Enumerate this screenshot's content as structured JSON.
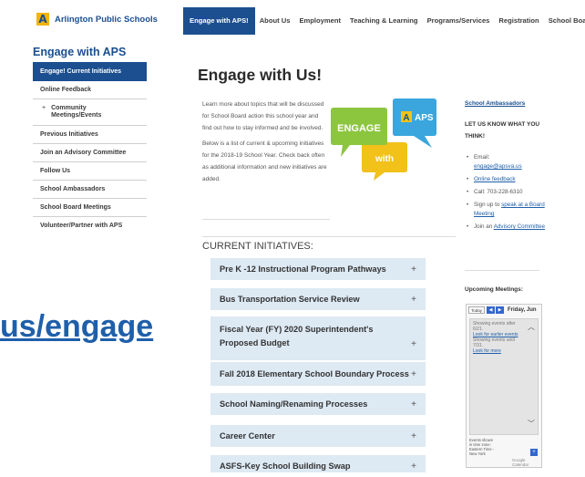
{
  "header": {
    "logo_letter": "A",
    "logo_text": "Arlington Public Schools",
    "nav": [
      "Engage with APS!",
      "About Us",
      "Employment",
      "Teaching & Learning",
      "Programs/Services",
      "Registration",
      "School Board"
    ]
  },
  "sidebar": {
    "title": "Engage with APS",
    "items": [
      "Engage! Current Initiatives",
      "Online Feedback",
      "Community Meetings/Events",
      "Previous Initiatives",
      "Join an Advisory Committee",
      "Follow Us",
      "School Ambassadors",
      "School Board Meetings",
      "Volunteer/Partner with APS"
    ],
    "sub_prefix": "+"
  },
  "main": {
    "title": "Engage with Us!",
    "intro_1": "Learn more about topics that will be discussed for School Board action this school year and find out how to stay informed and be involved.",
    "intro_2": "Below is a list of current & upcoming initiatives for the 2018-19 School Year. Check back often as additional information and new initiatives are added.",
    "graphic": {
      "engage": "ENGAGE",
      "with": "with",
      "aps": "APS"
    },
    "current_title": "CURRENT INITIATIVES:",
    "initiatives": [
      "Pre K -12 Instructional Program Pathways",
      "Bus Transportation Service Review",
      "Fiscal Year (FY) 2020 Superintendent's Proposed Budget",
      "Fall 2018 Elementary School Boundary Process",
      "School Naming/Renaming Processes",
      "Career Center",
      "ASFS-Key School Building Swap"
    ],
    "plus": "+"
  },
  "overlay": {
    "text": "us/engage"
  },
  "right": {
    "ambassadors_link": "School Ambassadors",
    "heading": "LET US KNOW WHAT YOU THINK!",
    "email_label": "Email:",
    "email": "engage@apsva.us",
    "online_feedback": "Online feedback",
    "call": "Call: 703-228-6310",
    "signup_prefix": "Sign up to",
    "signup_link": "speak at a Board Meeting",
    "join_prefix": "Join an",
    "join_link": "Advisory Committee",
    "upcoming": "Upcoming Meetings:",
    "calendar": {
      "today": "Today",
      "date": "Friday, Jun",
      "events_after": "Showing events after 6/21.",
      "look_earlier": "Look for earlier events",
      "events_until": "Showing events until 7/31.",
      "look_more": "Look for more",
      "tz_note": "Events shown in time zone: Eastern Time - New York",
      "powered": "Google Calendar"
    }
  },
  "colors": {
    "brand_blue": "#1b4f8f",
    "accordion_bg": "#dde9f3",
    "overlay_blue": "#1f5faa",
    "logo_gold": "#f2b40d"
  }
}
